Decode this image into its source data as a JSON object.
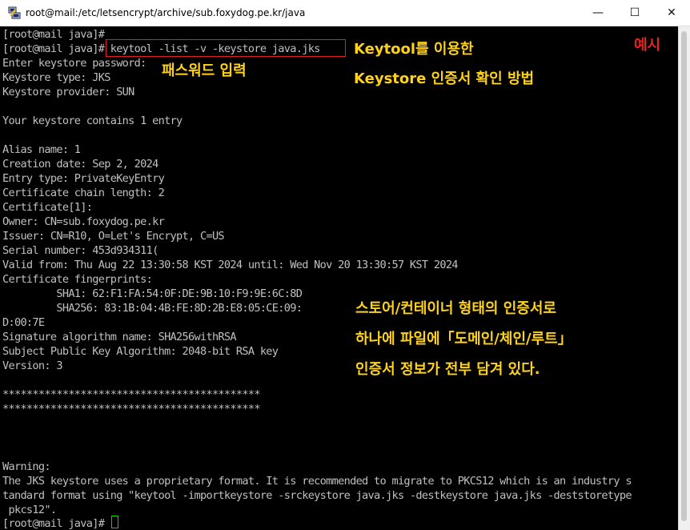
{
  "window": {
    "title": "root@mail:/etc/letsencrypt/archive/sub.foxydog.pe.kr/java",
    "icon": "putty-icon",
    "minimize": "—",
    "maximize": "☐",
    "close": "✕"
  },
  "terminal": {
    "lines": [
      "[root@mail java]#",
      "[root@mail java]# keytool -list -v -keystore java.jks",
      "Enter keystore password:",
      "Keystore type: JKS",
      "Keystore provider: SUN",
      "",
      "Your keystore contains 1 entry",
      "",
      "Alias name: 1",
      "Creation date: Sep 2, 2024",
      "Entry type: PrivateKeyEntry",
      "Certificate chain length: 2",
      "Certificate[1]:",
      "Owner: CN=sub.foxydog.pe.kr",
      "Issuer: CN=R10, O=Let's Encrypt, C=US",
      "Serial number: 453d934311(",
      "Valid from: Thu Aug 22 13:30:58 KST 2024 until: Wed Nov 20 13:30:57 KST 2024",
      "Certificate fingerprints:",
      "         SHA1: 62:F1:FA:54:0F:DE:9B:10:F9:9E:6C:8D",
      "         SHA256: 83:1B:04:4B:FE:8D:2B:E8:05:CE:09:",
      "D:00:7E",
      "Signature algorithm name: SHA256withRSA",
      "Subject Public Key Algorithm: 2048-bit RSA key",
      "Version: 3",
      "",
      "*******************************************",
      "*******************************************",
      "",
      "",
      "",
      "Warning:",
      "The JKS keystore uses a proprietary format. It is recommended to migrate to PKCS12 which is an industry s",
      "tandard format using \"keytool -importkeystore -srckeystore java.jks -destkeystore java.jks -deststoretype",
      " pkcs12\".",
      "[root@mail java]# "
    ]
  },
  "annotations": {
    "example": "예시",
    "password_input": "패스워드 입력",
    "title_line1": "Keytool를 이용한",
    "title_line2": "Keystore 인증서 확인 방법",
    "note_line1": "스토어/컨테이너 형태의 인증서로",
    "note_line2": "하나에 파일에「도메인/체인/루트」",
    "note_line3": "인증서 정보가 전부 담겨 있다."
  },
  "colors": {
    "terminal_bg": "#000000",
    "terminal_fg": "#c0c0c0",
    "annotation_yellow": "#ffd21a",
    "annotation_red": "#e82020",
    "cursor_green": "#00e000"
  }
}
